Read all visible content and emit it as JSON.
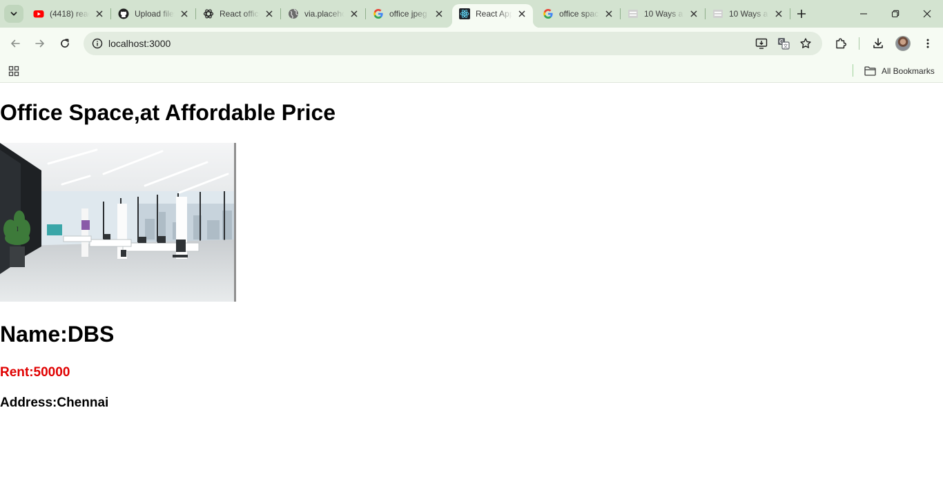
{
  "browser": {
    "tabs": [
      {
        "title": "(4418) react",
        "icon": "youtube-icon",
        "active": false
      },
      {
        "title": "Upload files",
        "icon": "github-icon",
        "active": false
      },
      {
        "title": "React office",
        "icon": "chatgpt-icon",
        "active": false
      },
      {
        "title": "via.placeholder",
        "icon": "globe-icon",
        "active": false
      },
      {
        "title": "office jpeg",
        "icon": "google-icon",
        "active": false
      },
      {
        "title": "React App",
        "icon": "react-icon",
        "active": true
      },
      {
        "title": "office space",
        "icon": "google-icon",
        "active": false
      },
      {
        "title": "10 Ways a",
        "icon": "document-icon",
        "active": false
      },
      {
        "title": "10 Ways a",
        "icon": "document-icon",
        "active": false
      }
    ],
    "url": "localhost:3000",
    "bookmarks_all_label": "All Bookmarks",
    "colors": {
      "tabstrip": "#d3e3d0",
      "toolbar": "#f6fbf3",
      "omnibox": "#e3ece0"
    }
  },
  "page": {
    "heading": "Office Space,at Affordable Price",
    "office": {
      "name_text": "Name:DBS",
      "rent_text": "Rent:50000",
      "address_text": "Address:Chennai"
    },
    "rent_color": "#e00000"
  }
}
